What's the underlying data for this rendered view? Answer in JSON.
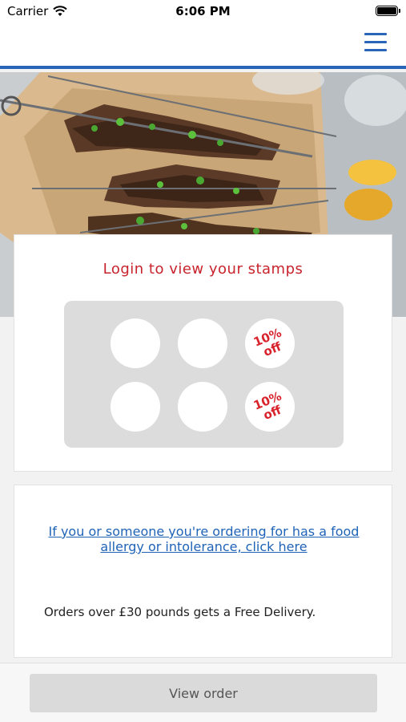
{
  "status_bar": {
    "carrier": "Carrier",
    "time": "6:06 PM"
  },
  "header": {
    "menu_icon": "hamburger-menu-icon"
  },
  "hero": {
    "image": "grilled-skewers-photo"
  },
  "stamps": {
    "title": "Login to view your stamps",
    "slots": [
      {
        "reward": ""
      },
      {
        "reward": ""
      },
      {
        "reward_line1": "10%",
        "reward_line2": "off"
      },
      {
        "reward": ""
      },
      {
        "reward": ""
      },
      {
        "reward_line1": "10%",
        "reward_line2": "off"
      }
    ]
  },
  "info": {
    "allergy_link": "If you or someone you're ordering for has a food allergy or intolerance, click here",
    "delivery_note": "Orders over £30 pounds gets a Free Delivery."
  },
  "footer": {
    "view_order_label": "View order"
  },
  "colors": {
    "accent": "#2a66b8",
    "stamp_red": "#c8232c",
    "link": "#1f63b7"
  }
}
